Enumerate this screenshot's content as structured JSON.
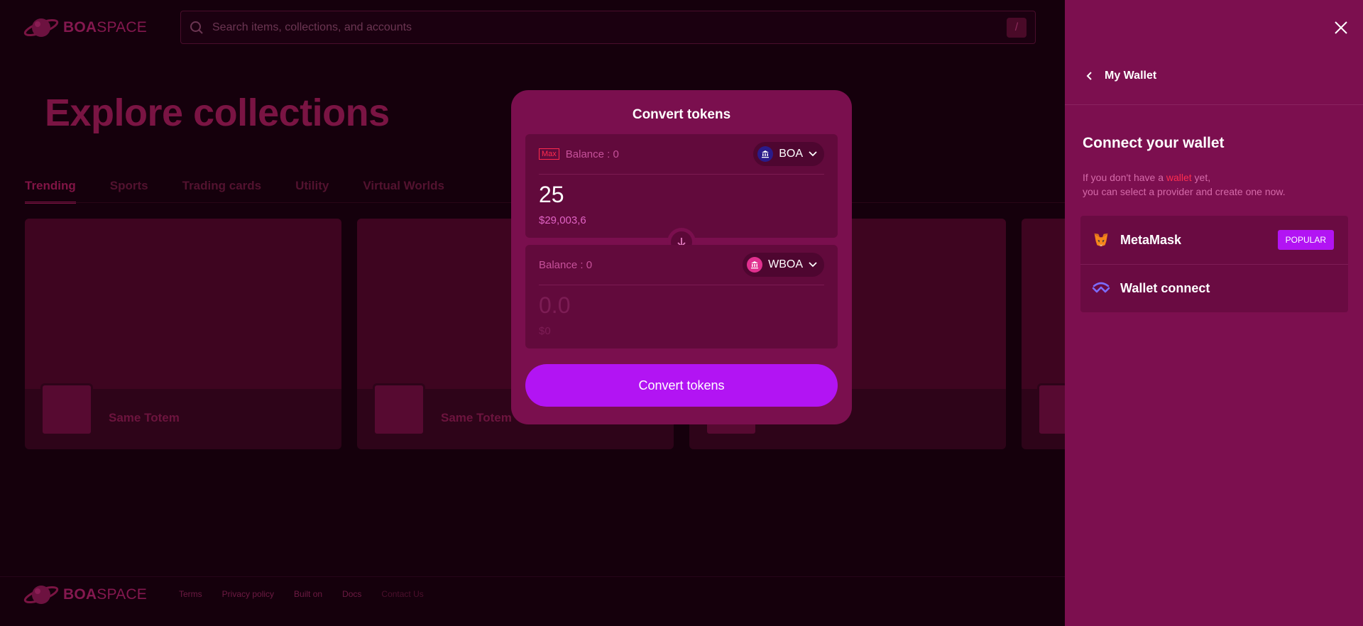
{
  "header": {
    "logo_bold": "BOA",
    "logo_light": "SPACE",
    "search_placeholder": "Search items, collections, and accounts",
    "search_shortcut": "/"
  },
  "hero": {
    "title": "Explore collections"
  },
  "tabs": [
    {
      "label": "Trending",
      "active": true
    },
    {
      "label": "Sports"
    },
    {
      "label": "Trading cards"
    },
    {
      "label": "Utility"
    },
    {
      "label": "Virtual Worlds"
    }
  ],
  "cards": [
    {
      "name": "Same Totem"
    },
    {
      "name": "Same Totem"
    },
    {
      "name": ""
    },
    {
      "name": ""
    }
  ],
  "footer": {
    "logo_bold": "BOA",
    "logo_light": "SPACE",
    "links": [
      "Terms",
      "Privacy policy",
      "Built on",
      "Docs",
      "Contact Us"
    ]
  },
  "modal": {
    "title": "Convert tokens",
    "from": {
      "max_label": "Max",
      "balance": "Balance : 0",
      "token": "BOA",
      "amount": "25",
      "usd": "$29,003,6"
    },
    "to": {
      "balance": "Balance : 0",
      "token": "WBOA",
      "amount": "0.0",
      "usd": "$0"
    },
    "button": "Convert tokens"
  },
  "wallet": {
    "back_title": "My Wallet",
    "heading": "Connect your wallet",
    "sub_pre": "If you don't have a ",
    "sub_link": "wallet",
    "sub_post": " yet,",
    "sub_line2": "you can select a provider and create one now.",
    "providers": [
      {
        "name": "MetaMask",
        "badge": "POPULAR"
      },
      {
        "name": "Wallet connect"
      }
    ]
  },
  "colors": {
    "accent": "#b214f3",
    "drawer_bg": "#7c0f4f",
    "page_bg": "#15000c",
    "highlight_red": "#ff2d4f"
  }
}
